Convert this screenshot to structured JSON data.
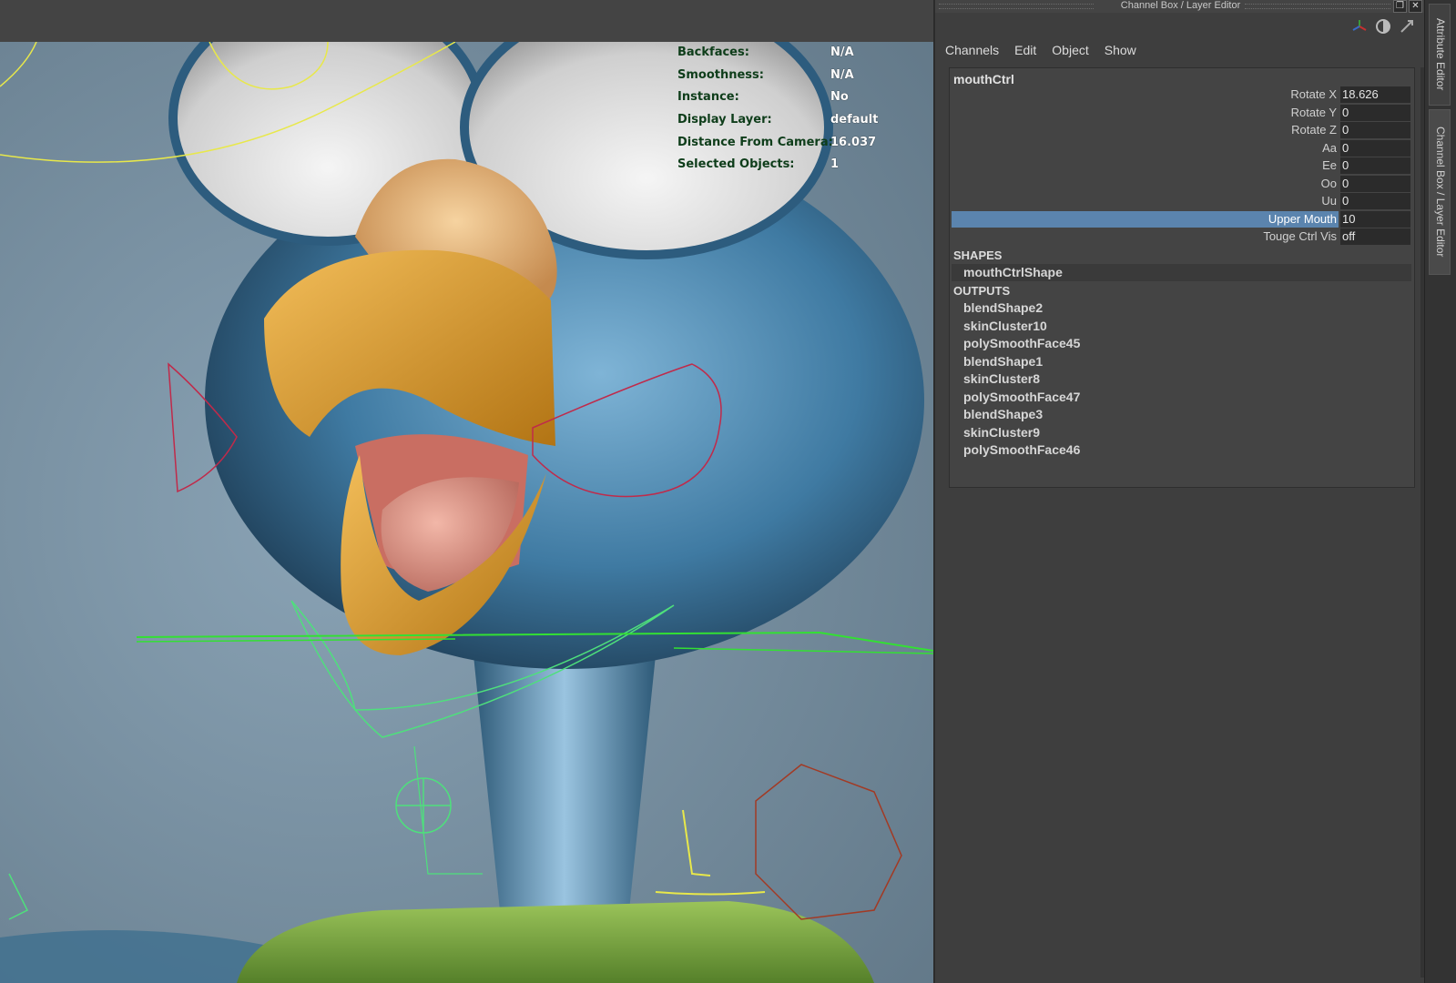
{
  "hud": {
    "rows": [
      {
        "label": "Backfaces:",
        "value": "N/A"
      },
      {
        "label": "Smoothness:",
        "value": "N/A"
      },
      {
        "label": "Instance:",
        "value": "No"
      },
      {
        "label": "Display Layer:",
        "value": "default"
      },
      {
        "label": "Distance From Camera:",
        "value": "16.037"
      },
      {
        "label": "Selected Objects:",
        "value": "1"
      }
    ]
  },
  "panel": {
    "title": "Channel Box / Layer Editor",
    "menu": [
      "Channels",
      "Edit",
      "Object",
      "Show"
    ],
    "node_name": "mouthCtrl",
    "attributes": [
      {
        "label": "Rotate X",
        "value": "18.626",
        "selected": false
      },
      {
        "label": "Rotate Y",
        "value": "0",
        "selected": false
      },
      {
        "label": "Rotate Z",
        "value": "0",
        "selected": false
      },
      {
        "label": "Aa",
        "value": "0",
        "selected": false
      },
      {
        "label": "Ee",
        "value": "0",
        "selected": false
      },
      {
        "label": "Oo",
        "value": "0",
        "selected": false
      },
      {
        "label": "Uu",
        "value": "0",
        "selected": false
      },
      {
        "label": "Upper Mouth",
        "value": "10",
        "selected": true
      },
      {
        "label": "Touge Ctrl Vis",
        "value": "off",
        "selected": false
      }
    ],
    "shapes_header": "SHAPES",
    "shapes": [
      "mouthCtrlShape"
    ],
    "outputs_header": "OUTPUTS",
    "outputs": [
      "blendShape2",
      "skinCluster10",
      "polySmoothFace45",
      "blendShape1",
      "skinCluster8",
      "polySmoothFace47",
      "blendShape3",
      "skinCluster9",
      "polySmoothFace46"
    ]
  },
  "side_tabs": {
    "attribute_editor": "Attribute Editor",
    "channel_box": "Channel Box / Layer Editor"
  }
}
